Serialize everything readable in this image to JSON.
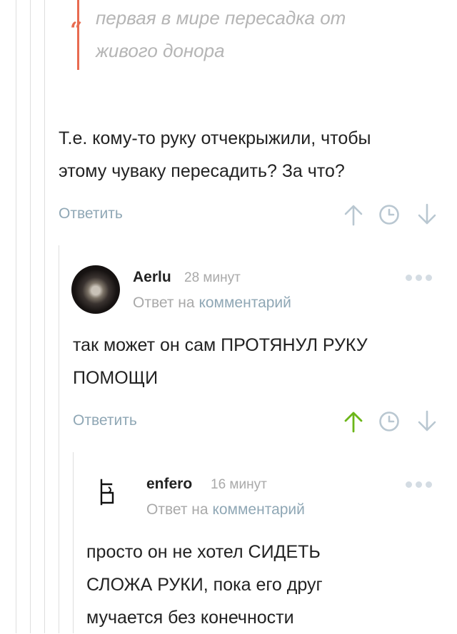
{
  "quote": {
    "lines": [
      "первая в мире пересадка от",
      "живого донора"
    ]
  },
  "comment_parent": {
    "lines": [
      "Т.е. кому-то руку отчекрыжили, чтобы",
      "этому чуваку пересадить? За что?"
    ],
    "reply_label": "Ответить"
  },
  "comment_aerlu": {
    "author": "Aerlu",
    "time": "28 минут",
    "reply_prefix": "Ответ на",
    "reply_link": "комментарий",
    "lines": [
      "так может он сам ПРОТЯНУЛ РУКУ",
      "ПОМОЩИ"
    ],
    "reply_label": "Ответить"
  },
  "comment_enfero": {
    "author": "enfero",
    "time": "16 минут",
    "reply_prefix": "Ответ на",
    "reply_link": "комментарий",
    "lines": [
      "просто он не хотел СИДЕТЬ",
      "СЛОЖА РУКИ, пока его друг",
      "мучается без конечности"
    ]
  },
  "colors": {
    "quote_accent": "#e86b50",
    "link": "#8fa7b5",
    "upvote_active": "#6cb619",
    "icon_inactive": "#b9c7d1"
  },
  "icons": [
    "upvote-arrow",
    "clock",
    "downvote-arrow",
    "more-dots"
  ]
}
